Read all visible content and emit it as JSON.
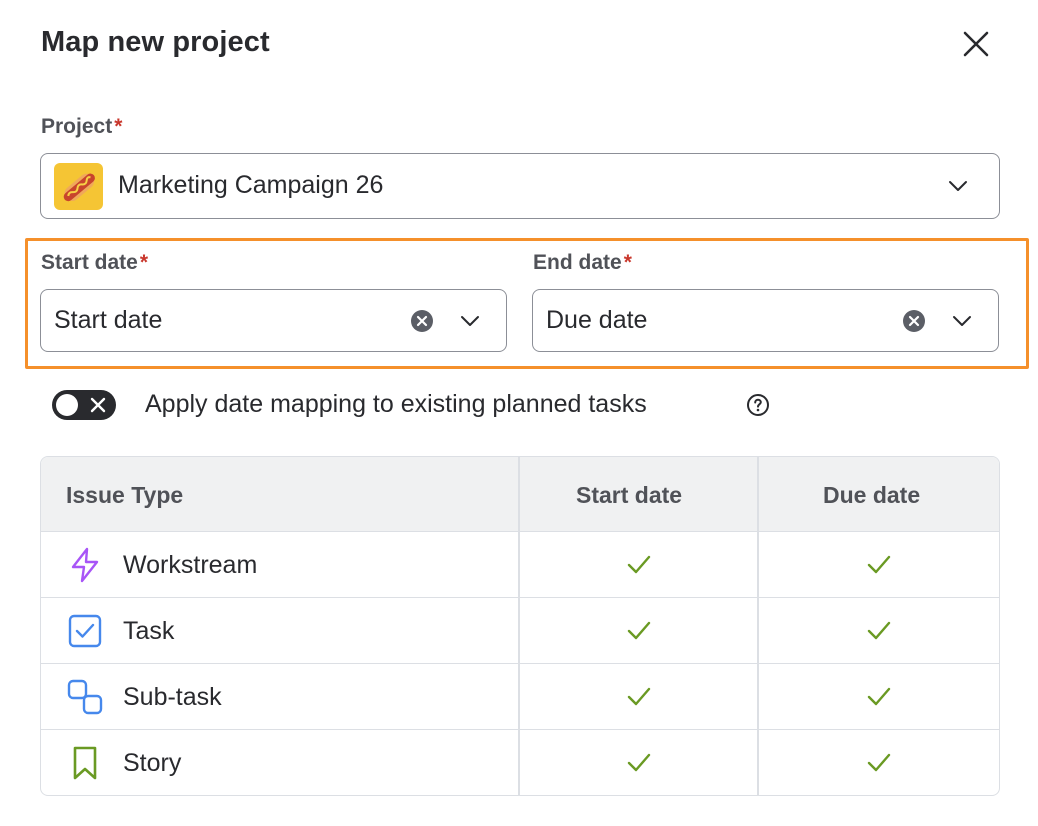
{
  "dialog": {
    "title": "Map new project",
    "close_icon": "close-icon"
  },
  "project": {
    "label": "Project",
    "required_mark": "*",
    "value": "Marketing Campaign 26",
    "avatar_icon": "hotdog-icon"
  },
  "start_date": {
    "label": "Start date",
    "required_mark": "*",
    "value": "Start date"
  },
  "end_date": {
    "label": "End date",
    "required_mark": "*",
    "value": "Due date"
  },
  "toggle": {
    "label": "Apply date mapping to existing planned tasks",
    "checked": false
  },
  "table": {
    "headers": [
      "Issue Type",
      "Start date",
      "Due date"
    ],
    "rows": [
      {
        "label": "Workstream",
        "icon": "lightning-icon",
        "start": true,
        "due": true
      },
      {
        "label": "Task",
        "icon": "checkbox-icon",
        "start": true,
        "due": true
      },
      {
        "label": "Sub-task",
        "icon": "subtask-icon",
        "start": true,
        "due": true
      },
      {
        "label": "Story",
        "icon": "bookmark-icon",
        "start": true,
        "due": true
      }
    ]
  },
  "colors": {
    "highlight": "#f5902b",
    "required": "#c9372c",
    "check": "#6a9a23",
    "workstream": "#a855f7",
    "task": "#4688ec",
    "story": "#6a9a23"
  }
}
